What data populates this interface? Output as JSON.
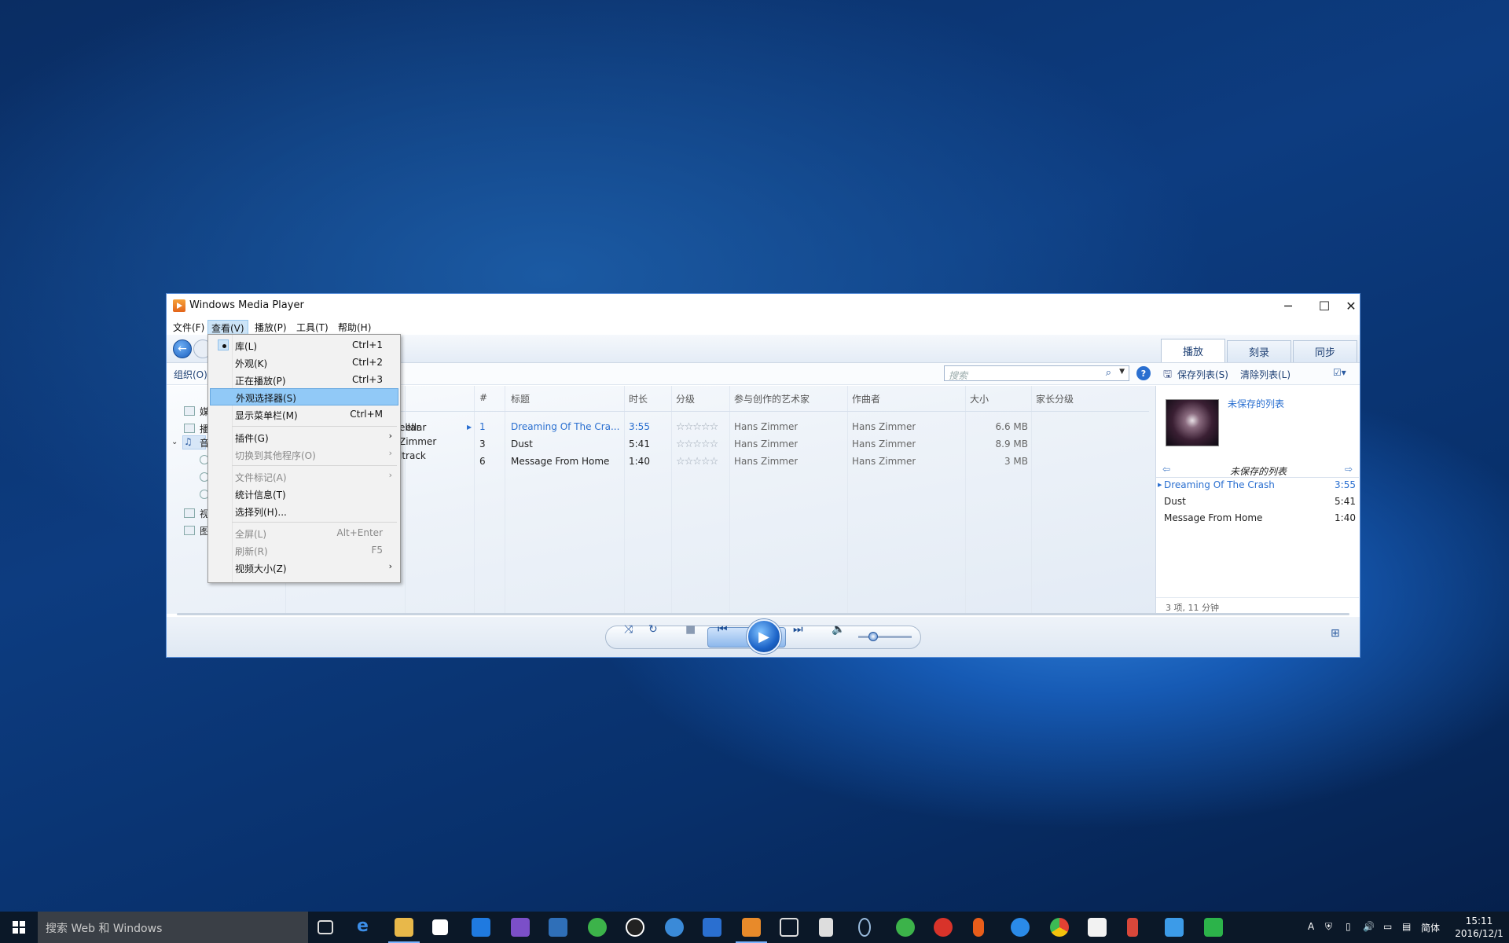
{
  "window": {
    "title": "Windows Media Player",
    "controls": {
      "minimize": "─",
      "maximize": "☐",
      "close": "✕"
    }
  },
  "menubar": [
    "文件(F)",
    "查看(V)",
    "播放(P)",
    "工具(T)",
    "帮助(H)"
  ],
  "tabs": [
    "播放",
    "刻录",
    "同步"
  ],
  "toolbar": {
    "organize": "组织(O)",
    "save_list": "保存列表(S)",
    "clear_list": "清除列表(L)"
  },
  "search": {
    "placeholder": "搜索"
  },
  "nav_items": [
    "媒",
    "播",
    "音",
    "视",
    "图"
  ],
  "columns": [
    "#",
    "标题",
    "时长",
    "分级",
    "参与创作的艺术家",
    "作曲者",
    "大小",
    "家长分级"
  ],
  "album_fragments": [
    "ellar",
    "Zimmer",
    "ltrack"
  ],
  "tracks": [
    {
      "num": "1",
      "title": "Dreaming Of The Cra...",
      "duration": "3:55",
      "rating": "☆☆☆☆☆",
      "artist": "Hans Zimmer",
      "composer": "Hans Zimmer",
      "size": "6.6 MB"
    },
    {
      "num": "3",
      "title": "Dust",
      "duration": "5:41",
      "rating": "☆☆☆☆☆",
      "artist": "Hans Zimmer",
      "composer": "Hans Zimmer",
      "size": "8.9 MB"
    },
    {
      "num": "6",
      "title": "Message From Home",
      "duration": "1:40",
      "rating": "☆☆☆☆☆",
      "artist": "Hans Zimmer",
      "composer": "Hans Zimmer",
      "size": "3 MB"
    }
  ],
  "playlist": {
    "title_link": "未保存的列表",
    "header": "未保存的列表",
    "items": [
      {
        "title": "Dreaming Of The Crash",
        "duration": "3:55"
      },
      {
        "title": "Dust",
        "duration": "5:41"
      },
      {
        "title": "Message From Home",
        "duration": "1:40"
      }
    ],
    "summary": "3 项, 11 分钟"
  },
  "view_menu": [
    {
      "label": "库(L)",
      "shortcut": "Ctrl+1"
    },
    {
      "label": "外观(K)",
      "shortcut": "Ctrl+2"
    },
    {
      "label": "正在播放(P)",
      "shortcut": "Ctrl+3"
    },
    {
      "label": "外观选择器(S)",
      "shortcut": ""
    },
    {
      "label": "显示菜单栏(M)",
      "shortcut": "Ctrl+M"
    },
    {
      "label": "插件(G)",
      "shortcut": ""
    },
    {
      "label": "切换到其他程序(O)",
      "shortcut": ""
    },
    {
      "label": "文件标记(A)",
      "shortcut": ""
    },
    {
      "label": "统计信息(T)",
      "shortcut": ""
    },
    {
      "label": "选择列(H)...",
      "shortcut": ""
    },
    {
      "label": "全屏(L)",
      "shortcut": "Alt+Enter"
    },
    {
      "label": "刷新(R)",
      "shortcut": "F5"
    },
    {
      "label": "视频大小(Z)",
      "shortcut": ""
    }
  ],
  "taskbar": {
    "search_placeholder": "搜索 Web 和 Windows",
    "ime": "简体",
    "time": "15:11",
    "date": "2016/12/1"
  }
}
